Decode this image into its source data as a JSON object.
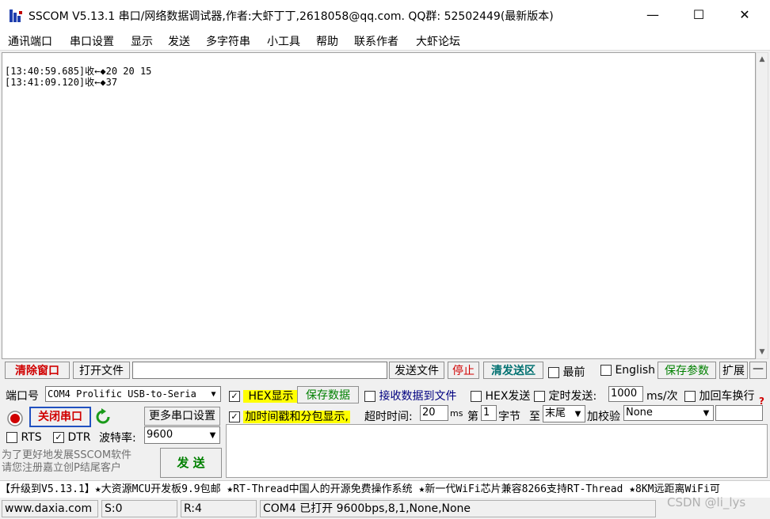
{
  "window": {
    "title": "SSCOM V5.13.1 串口/网络数据调试器,作者:大虾丁丁,2618058@qq.com. QQ群: 52502449(最新版本)",
    "minimize": "—",
    "maximize": "☐",
    "close": "✕"
  },
  "menu": [
    "通讯端口",
    "串口设置",
    "显示",
    "发送",
    "多字符串",
    "小工具",
    "帮助",
    "联系作者",
    "大虾论坛"
  ],
  "receive": {
    "lines": [
      "[13:40:59.685]收←◆20 20 15",
      "[13:41:09.120]收←◆37"
    ]
  },
  "toolbar": {
    "clear_window": "清除窗口",
    "open_file": "打开文件",
    "file_path": "",
    "send_file": "发送文件",
    "stop": "停止",
    "clear_send": "清发送区",
    "topmost": "最前",
    "english": "English",
    "save_params": "保存参数",
    "expand": "扩展",
    "collapse": "—"
  },
  "port": {
    "port_label": "端口号",
    "port_value": "COM4 Prolific USB-to-Seria",
    "close_port": "关闭串口",
    "more_settings": "更多串口设置",
    "rts": "RTS",
    "dtr": "DTR",
    "baud_label": "波特率:",
    "baud_value": "9600",
    "promo_text": "为了更好地发展SSCOM软件\n请您注册嘉立创P结尾客户",
    "send_button": "发 送"
  },
  "options": {
    "hex_display": "HEX显示",
    "save_data": "保存数据",
    "recv_to_file": "接收数据到文件",
    "hex_send": "HEX发送",
    "timed_send": "定时发送:",
    "interval": "1000",
    "interval_unit": "ms/次",
    "add_crlf": "加回车换行",
    "timestamp": "加时间戳和分包显示,",
    "timeout_label": "超时时间:",
    "timeout_value": "20",
    "timeout_unit": "ms",
    "nth_label": "第",
    "nth_value": "1",
    "byte_label": "字节",
    "to_label": "至",
    "end_value": "末尾",
    "checksum_label": "加校验",
    "checksum_value": "None",
    "help_icon": "?"
  },
  "marquee": "【升级到V5.13.1】★大资源MCU开发板9.9包邮 ★RT-Thread中国人的开源免费操作系统 ★新一代WiFi芯片兼容8266支持RT-Thread ★8KM远距离WiFi可",
  "status": {
    "website": "www.daxia.com",
    "sent": "S:0",
    "received": "R:4",
    "port_status": "COM4 已打开  9600bps,8,1,None,None",
    "watermark": "CSDN @li_lys"
  },
  "colors": {
    "highlight_yellow": "#ffff00",
    "accent_red": "#d00000",
    "accent_green": "#008000"
  }
}
